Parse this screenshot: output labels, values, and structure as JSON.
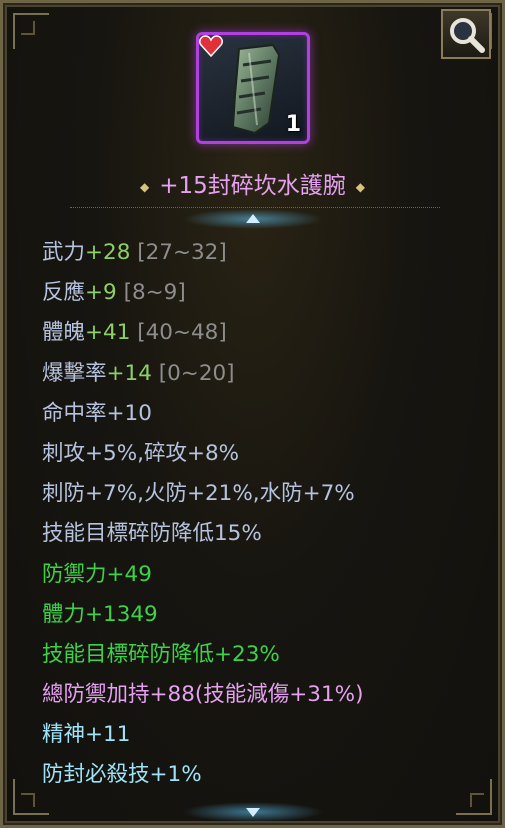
{
  "item": {
    "name": "+15封碎坎水護腕",
    "quantity": "1",
    "icon": "bracer-icon",
    "badge_icon": "heart-icon",
    "rarity_color": "#b040e0"
  },
  "toolbar": {
    "zoom_icon": "magnifier-icon"
  },
  "base_stats": [
    {
      "label": "武力",
      "bonus": "+28",
      "range": "[27~32]"
    },
    {
      "label": "反應",
      "bonus": "+9",
      "range": "[8~9]"
    },
    {
      "label": "體魄",
      "bonus": "+41",
      "range": "[40~48]"
    },
    {
      "label": "爆擊率",
      "bonus": "+14",
      "range": "[0~20]"
    }
  ],
  "extra_stats": [
    {
      "text": "命中率+10",
      "color": "base"
    },
    {
      "text": "刺攻+5%,碎攻+8%",
      "color": "base"
    },
    {
      "text": "刺防+7%,火防+21%,水防+7%",
      "color": "base"
    },
    {
      "text": "技能目標碎防降低15%",
      "color": "base"
    },
    {
      "text": "防禦力+49",
      "color": "green"
    },
    {
      "text": "體力+1349",
      "color": "green"
    },
    {
      "text": "技能目標碎防降低+23%",
      "color": "green"
    },
    {
      "text": "總防禦加持+88(技能減傷+31%)",
      "color": "purple"
    },
    {
      "text": "精神+11",
      "color": "cyan"
    },
    {
      "text": "防封必殺技+1%",
      "color": "cyan"
    }
  ]
}
